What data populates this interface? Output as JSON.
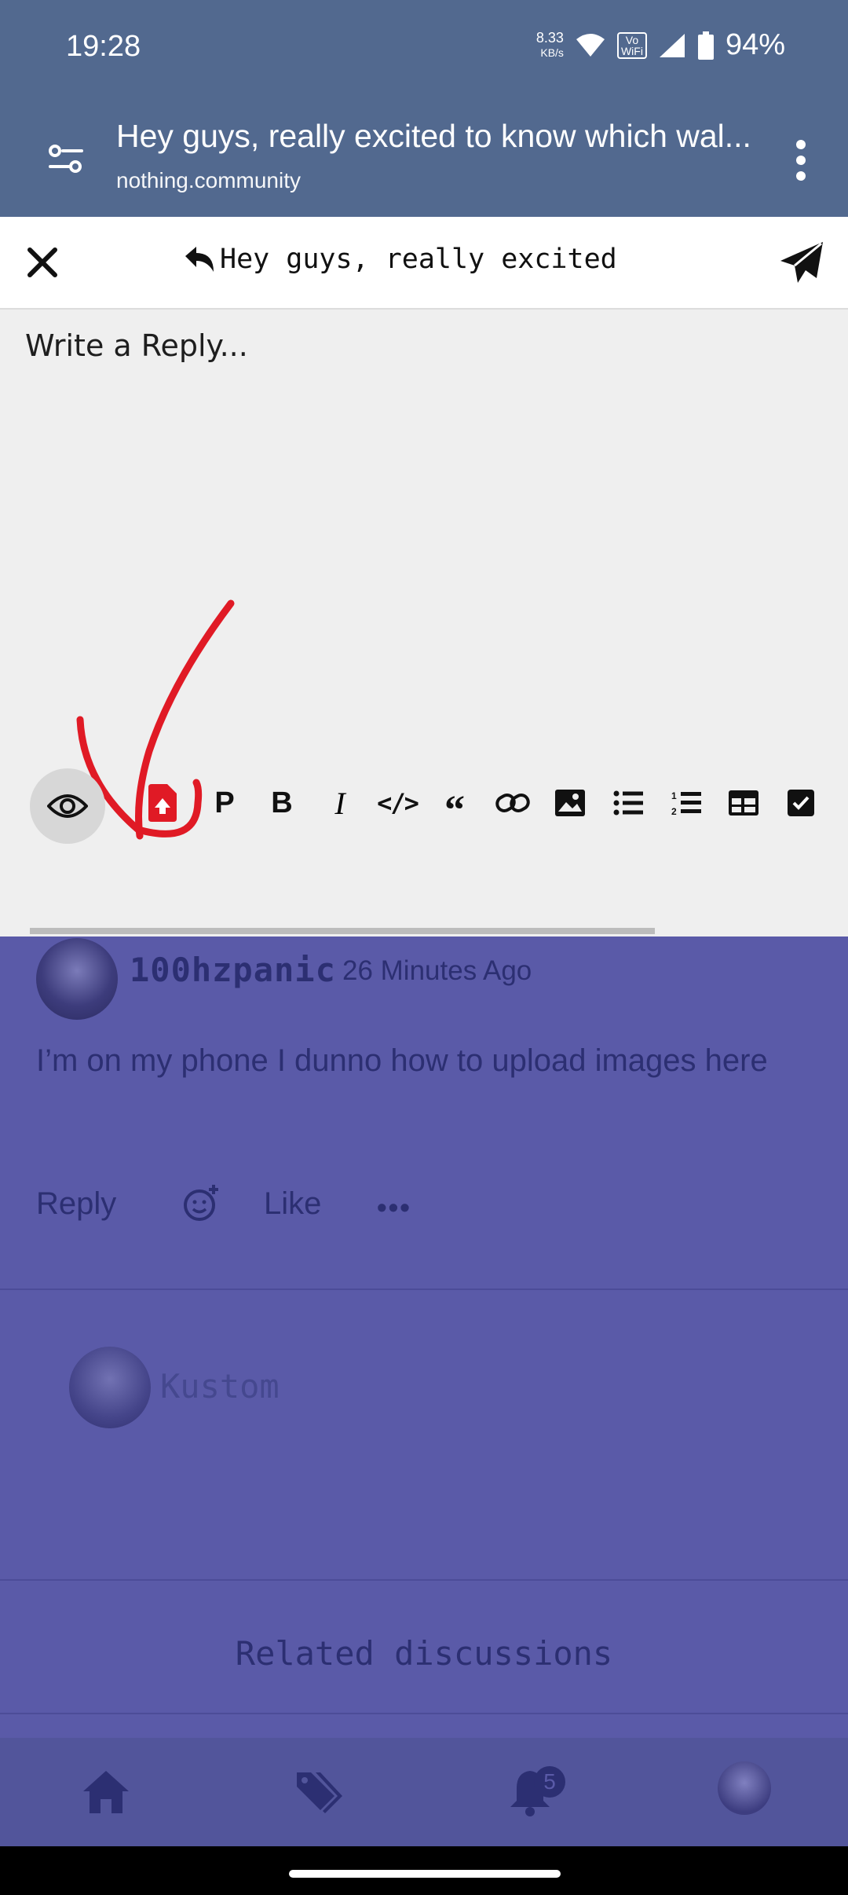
{
  "status_bar": {
    "time": "19:28",
    "net_speed_value": "8.33",
    "net_speed_unit": "KB/s",
    "volte_line1": "Vo",
    "volte_line2": "WiFi",
    "battery": "94%"
  },
  "browser": {
    "title": "Hey guys, really excited to know which wal...",
    "url": "nothing.community"
  },
  "composer": {
    "reply_title": "Hey guys, really excited",
    "placeholder": "Write a Reply...",
    "toolbar": [
      "preview",
      "upload",
      "P",
      "B",
      "I",
      "</>",
      "“",
      "link",
      "image",
      "bullet-list",
      "numbered-list",
      "table",
      "checkbox"
    ]
  },
  "post": {
    "author": "100hzpanic",
    "time": "26 Minutes Ago",
    "body": "I’m on my phone I dunno how to upload images here",
    "reply_label": "Reply",
    "like_label": "Like",
    "more_label": "•••"
  },
  "reply_preview": {
    "author": "Kustom"
  },
  "related": {
    "heading": "Related discussions"
  },
  "bottom_nav": {
    "notifications_count": "5"
  },
  "colors": {
    "annotation": "#e01a25",
    "overlay": "#5a5aa8",
    "toolbar_bar": "#52698f"
  }
}
